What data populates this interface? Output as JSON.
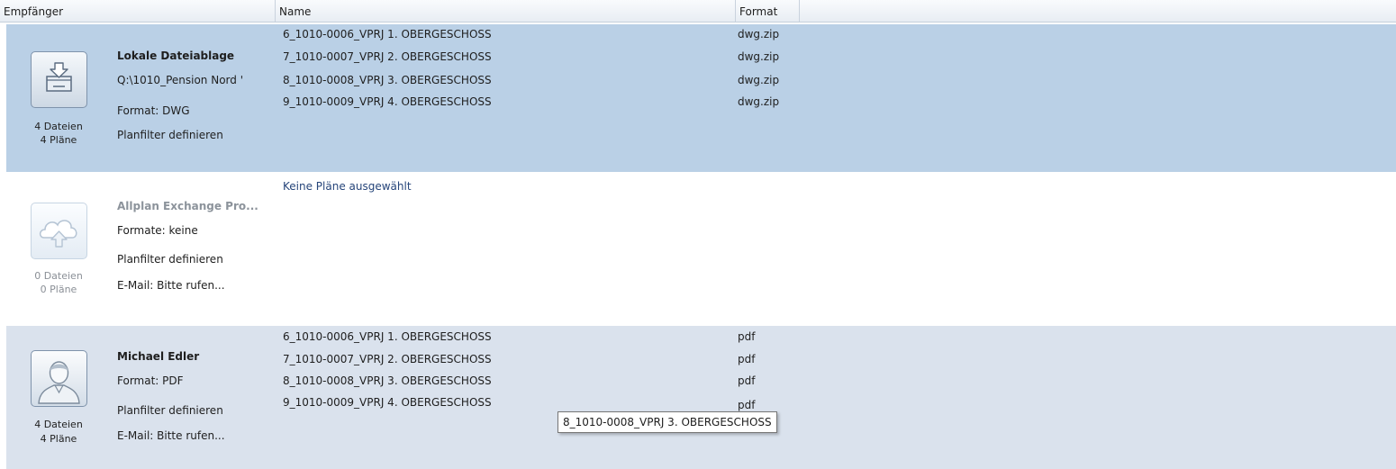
{
  "columns": {
    "recipient": "Empfänger",
    "name": "Name",
    "format": "Format"
  },
  "recipients": [
    {
      "icon": "folder-download-icon",
      "title": "Lokale Dateiablage",
      "lines": [
        "Q:\\1010_Pension Nord '",
        "Format: DWG",
        "Planfilter definieren"
      ],
      "files_count": "4 Dateien",
      "plans_count": "4 Pläne",
      "files": [
        {
          "name": "6_1010-0006_VPRJ 1. OBERGESCHOSS",
          "format": "dwg.zip"
        },
        {
          "name": "7_1010-0007_VPRJ 2. OBERGESCHOSS",
          "format": "dwg.zip"
        },
        {
          "name": "8_1010-0008_VPRJ 3. OBERGESCHOSS",
          "format": "dwg.zip"
        },
        {
          "name": "9_1010-0009_VPRJ 4. OBERGESCHOSS",
          "format": "dwg.zip"
        }
      ]
    },
    {
      "icon": "cloud-upload-icon",
      "title": "Allplan Exchange Pro...",
      "lines": [
        "Formate: keine",
        "Planfilter definieren",
        "E-Mail: Bitte rufen..."
      ],
      "files_count": "0 Dateien",
      "plans_count": "0 Pläne",
      "empty_message": "Keine Pläne ausgewählt",
      "files": []
    },
    {
      "icon": "user-avatar-icon",
      "title": "Michael Edler",
      "lines": [
        "Format: PDF",
        "Planfilter definieren",
        "E-Mail: Bitte rufen..."
      ],
      "files_count": "4 Dateien",
      "plans_count": "4 Pläne",
      "files": [
        {
          "name": "6_1010-0006_VPRJ 1. OBERGESCHOSS",
          "format": "pdf"
        },
        {
          "name": "7_1010-0007_VPRJ 2. OBERGESCHOSS",
          "format": "pdf"
        },
        {
          "name": "8_1010-0008_VPRJ 3. OBERGESCHOSS",
          "format": "pdf"
        },
        {
          "name": "9_1010-0009_VPRJ 4. OBERGESCHOSS",
          "format": "pdf"
        }
      ]
    }
  ],
  "tooltip": "8_1010-0008_VPRJ 3. OBERGESCHOSS",
  "colors": {
    "selected_row": "#bad0e6",
    "alt_row": "#dae2ed",
    "link_text": "#26457a"
  }
}
